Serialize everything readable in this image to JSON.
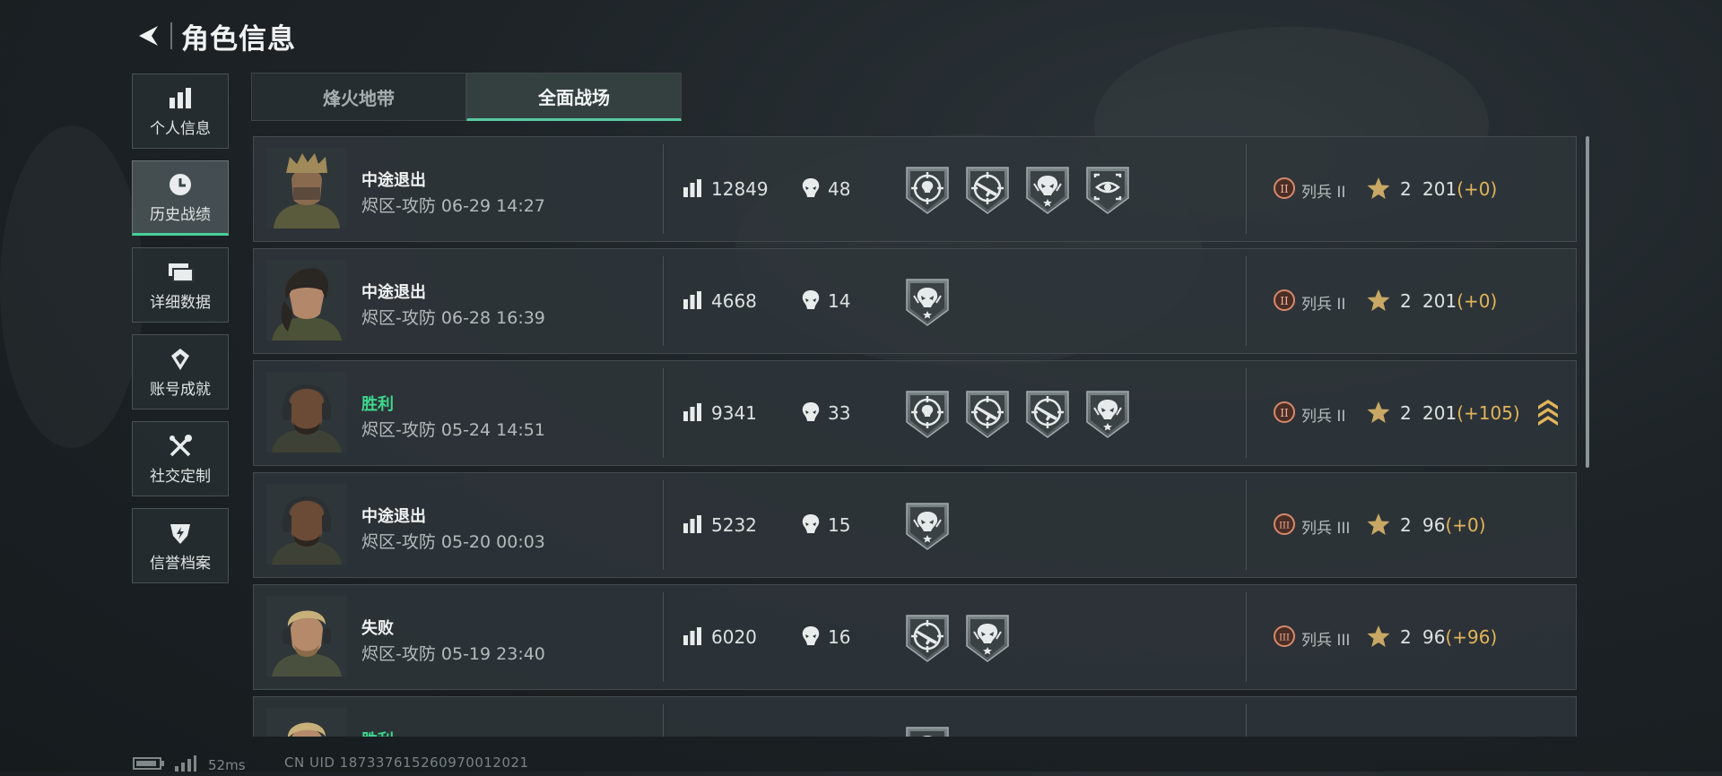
{
  "header": {
    "title": "角色信息"
  },
  "sidebar": {
    "items": [
      {
        "label": "个人信息",
        "icon": "bar-chart-icon"
      },
      {
        "label": "历史战绩",
        "icon": "clock-icon",
        "active": true
      },
      {
        "label": "详细数据",
        "icon": "cards-icon"
      },
      {
        "label": "账号成就",
        "icon": "achievement-icon"
      },
      {
        "label": "社交定制",
        "icon": "tools-icon"
      },
      {
        "label": "信誉档案",
        "icon": "shield-icon"
      }
    ]
  },
  "tabs": [
    {
      "label": "烽火地带",
      "active": false
    },
    {
      "label": "全面战场",
      "active": true
    }
  ],
  "matches": [
    {
      "result": "中途退出",
      "mode": "烬区-攻防 06-29 14:27",
      "score": "12849",
      "kills": "48",
      "medals": [
        "target-skull-medal",
        "target-rifle-medal",
        "alien-skull-medal",
        "crosshair-eye-medal"
      ],
      "rank": "列兵 II",
      "rank_numeral": "II",
      "stars": "2",
      "points": "201",
      "delta": "(+0)",
      "promo": false
    },
    {
      "result": "中途退出",
      "mode": "烬区-攻防 06-28 16:39",
      "score": "4668",
      "kills": "14",
      "medals": [
        "alien-skull-medal"
      ],
      "rank": "列兵 II",
      "rank_numeral": "II",
      "stars": "2",
      "points": "201",
      "delta": "(+0)",
      "promo": false
    },
    {
      "result": "胜利",
      "mode": "烬区-攻防 05-24 14:51",
      "score": "9341",
      "kills": "33",
      "medals": [
        "target-skull-medal",
        "target-rifle-medal",
        "target-rifle-medal",
        "alien-skull-medal"
      ],
      "rank": "列兵 II",
      "rank_numeral": "II",
      "stars": "2",
      "points": "201",
      "delta": "(+105)",
      "promo": true
    },
    {
      "result": "中途退出",
      "mode": "烬区-攻防 05-20 00:03",
      "score": "5232",
      "kills": "15",
      "medals": [
        "alien-skull-medal"
      ],
      "rank": "列兵 III",
      "rank_numeral": "III",
      "stars": "2",
      "points": "96",
      "delta": "(+0)",
      "promo": false
    },
    {
      "result": "失败",
      "mode": "烬区-攻防 05-19 23:40",
      "score": "6020",
      "kills": "16",
      "medals": [
        "target-rifle-medal",
        "alien-skull-medal"
      ],
      "rank": "列兵 III",
      "rank_numeral": "III",
      "stars": "2",
      "points": "96",
      "delta": "(+96)",
      "promo": false
    },
    {
      "result": "胜利",
      "mode": "",
      "score": "",
      "kills": "",
      "medals": [
        "alien-skull-medal"
      ],
      "rank": "",
      "rank_numeral": "",
      "stars": "",
      "points": "",
      "delta": "",
      "promo": false
    }
  ],
  "footer": {
    "ping": "52ms",
    "uid": "CN UID 187337615260970012021"
  },
  "colors": {
    "accent": "#45d09a",
    "win": "#3fd88e",
    "delta": "#e2b55a",
    "rank_badge": "#d9896a"
  }
}
